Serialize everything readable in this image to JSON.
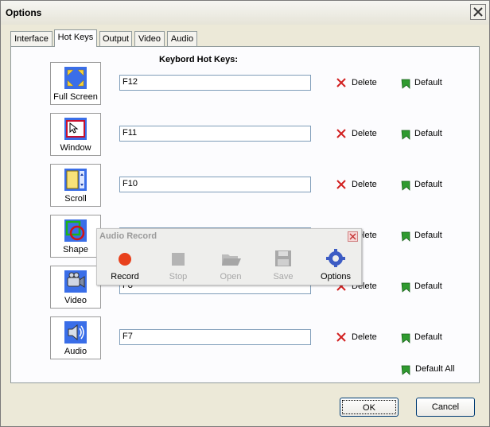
{
  "window": {
    "title": "Options"
  },
  "tabs": [
    {
      "label": "Interface",
      "active": false
    },
    {
      "label": "Hot Keys",
      "active": true
    },
    {
      "label": "Output",
      "active": false
    },
    {
      "label": "Video",
      "active": false
    },
    {
      "label": "Audio",
      "active": false
    }
  ],
  "hotkeys": {
    "heading": "Keybord Hot Keys:",
    "delete_label": "Delete",
    "default_label": "Default",
    "default_all_label": "Default All",
    "rows": [
      {
        "label": "Full Screen",
        "icon": "fullscreen-icon",
        "value": "F12"
      },
      {
        "label": "Window",
        "icon": "window-icon",
        "value": "F11"
      },
      {
        "label": "Scroll",
        "icon": "scroll-icon",
        "value": "F10"
      },
      {
        "label": "Shape",
        "icon": "shape-icon",
        "value": ""
      },
      {
        "label": "Video",
        "icon": "video-camera-icon",
        "value": "F8"
      },
      {
        "label": "Audio",
        "icon": "speaker-icon",
        "value": "F7"
      }
    ]
  },
  "audio_record": {
    "title": "Audio Record",
    "buttons": [
      {
        "label": "Record",
        "enabled": true
      },
      {
        "label": "Stop",
        "enabled": false
      },
      {
        "label": "Open",
        "enabled": false
      },
      {
        "label": "Save",
        "enabled": false
      },
      {
        "label": "Options",
        "enabled": true
      }
    ]
  },
  "footer": {
    "ok_label": "OK",
    "cancel_label": "Cancel"
  },
  "colors": {
    "delete_red": "#d22020",
    "default_green": "#2f9a2f",
    "panel": "#fcfcfe",
    "face": "#ece9d8"
  }
}
